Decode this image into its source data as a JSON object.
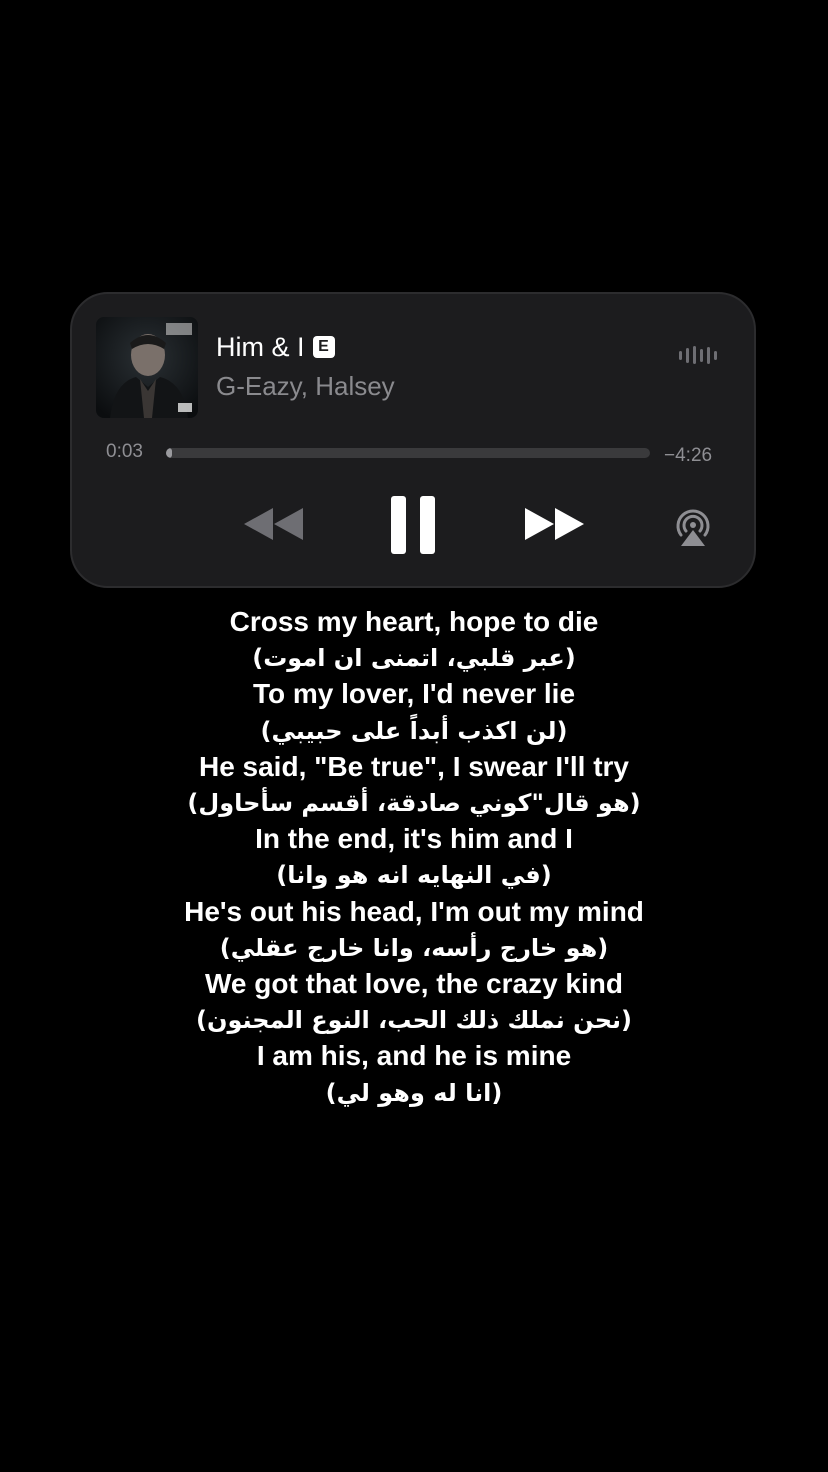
{
  "now_playing": {
    "title": "Him & I",
    "explicit_badge": "E",
    "artist": "G-Eazy, Halsey",
    "time_elapsed": "0:03",
    "time_remaining": "−4:26",
    "progress_fraction": 0.012
  },
  "controls": {
    "rewind_icon": "rewind-icon",
    "pause_icon": "pause-icon",
    "forward_icon": "fast-forward-icon",
    "airplay_icon": "airplay-audio-icon",
    "waveform_icon": "waveform-icon"
  },
  "colors": {
    "card_background": "#1c1c1e",
    "secondary_text": "#8a8a8e",
    "background": "#000000"
  },
  "lyrics": [
    {
      "text": "Cross my heart, hope to die",
      "lang": "en"
    },
    {
      "text": "(عبر قلبي، اتمنى ان اموت)",
      "lang": "ar"
    },
    {
      "text": "To my lover, I'd never lie",
      "lang": "en"
    },
    {
      "text": "(لن اكذب أبداً على حبيبي)",
      "lang": "ar"
    },
    {
      "text": "He said, \"Be true\", I swear I'll try",
      "lang": "en"
    },
    {
      "text": "(هو قال\"كوني صادقة، أقسم سأحاول)",
      "lang": "ar"
    },
    {
      "text": "In the end, it's him and I",
      "lang": "en"
    },
    {
      "text": "(في النهايه انه هو وانا)",
      "lang": "ar"
    },
    {
      "text": "He's out his head, I'm out my mind",
      "lang": "en"
    },
    {
      "text": "(هو خارج رأسه، وانا خارج عقلي)",
      "lang": "ar"
    },
    {
      "text": "We got that love, the crazy kind",
      "lang": "en"
    },
    {
      "text": "(نحن نملك ذلك الحب، النوع المجنون)",
      "lang": "ar"
    },
    {
      "text": "I am his, and he is mine",
      "lang": "en"
    },
    {
      "text": "(انا له وهو لي)",
      "lang": "ar"
    }
  ]
}
